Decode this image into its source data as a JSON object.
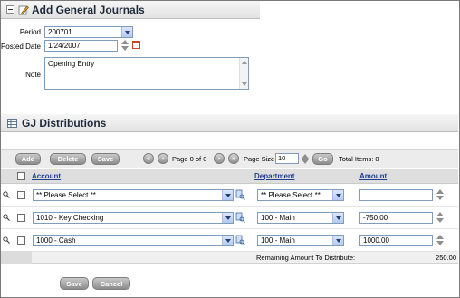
{
  "general": {
    "title": "Add General Journals",
    "period_label": "Period",
    "period_value": "200701",
    "posted_date_label": "Posted Date",
    "posted_date_value": "1/24/2007",
    "note_label": "Note",
    "note_value": "Opening Entry"
  },
  "distributions": {
    "title": "GJ Distributions",
    "toolbar": {
      "add_label": "Add",
      "delete_label": "Delete",
      "save_label": "Save",
      "page_text": "Page 0 of 0",
      "page_size_label": "Page Size",
      "page_size_value": "10",
      "go_label": "Go",
      "total_items_text": "Total Items: 0"
    },
    "columns": {
      "account": "Account",
      "department": "Department",
      "amount": "Amount"
    },
    "rows": [
      {
        "account": "** Please Select **",
        "department": "** Please Select **",
        "amount": ""
      },
      {
        "account": "1010 - Key Checking",
        "department": "100 - Main",
        "amount": "-750.00"
      },
      {
        "account": "1000 - Cash",
        "department": "100 - Main",
        "amount": "1000.00"
      }
    ],
    "remaining_label": "Remaining Amount To Distribute:",
    "remaining_value": "250.00"
  },
  "footer": {
    "save_label": "Save",
    "cancel_label": "Cancel"
  },
  "colors": {
    "header_text": "#1e2a3a",
    "column_link": "#1f3f8f",
    "input_border": "#7f9db9"
  }
}
